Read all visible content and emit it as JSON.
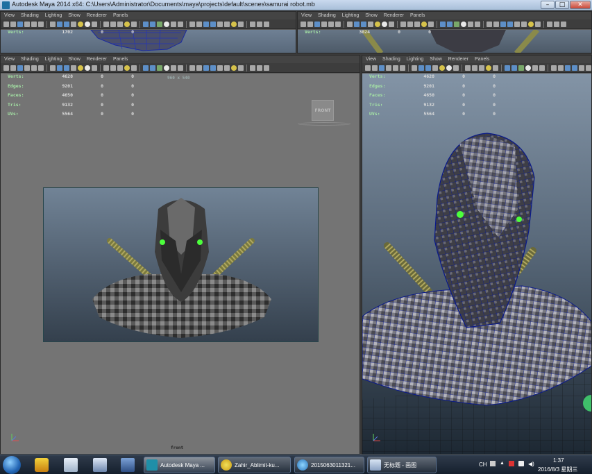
{
  "window": {
    "title": "Autodesk Maya 2014 x64: C:\\Users\\Administrator\\Documents\\maya\\projects\\default\\scenes\\samurai robot.mb",
    "controls": {
      "minimize": "–",
      "maximize": "□",
      "close": "✕"
    }
  },
  "panel_menu": [
    "View",
    "Shading",
    "Lighting",
    "Show",
    "Renderer",
    "Panels"
  ],
  "top_left_panel": {
    "hud": [
      {
        "label": "Verts:",
        "values": [
          "1702",
          "0",
          "0"
        ]
      }
    ]
  },
  "top_right_panel": {
    "hud": [
      {
        "label": "Verts:",
        "values": [
          "3024",
          "0",
          "0"
        ]
      }
    ]
  },
  "front_panel": {
    "resolution": "960 x 540",
    "cube_label": "FRONT",
    "camera_label": "front",
    "hud": [
      {
        "label": "Verts:",
        "values": [
          "4628",
          "0",
          "0"
        ]
      },
      {
        "label": "Edges:",
        "values": [
          "9201",
          "0",
          "0"
        ]
      },
      {
        "label": "Faces:",
        "values": [
          "4650",
          "0",
          "0"
        ]
      },
      {
        "label": "Tris:",
        "values": [
          "9132",
          "0",
          "0"
        ]
      },
      {
        "label": "UVs:",
        "values": [
          "5564",
          "0",
          "0"
        ]
      }
    ]
  },
  "persp_panel": {
    "hud": [
      {
        "label": "Verts:",
        "values": [
          "4628",
          "0",
          "0"
        ]
      },
      {
        "label": "Edges:",
        "values": [
          "9201",
          "0",
          "0"
        ]
      },
      {
        "label": "Faces:",
        "values": [
          "4650",
          "0",
          "0"
        ]
      },
      {
        "label": "Tris:",
        "values": [
          "9132",
          "0",
          "0"
        ]
      },
      {
        "label": "UVs:",
        "values": [
          "5564",
          "0",
          "0"
        ]
      }
    ]
  },
  "taskbar": {
    "tasks": [
      {
        "label": "Autodesk Maya ...",
        "icon": "maya-icon"
      },
      {
        "label": "Zahir_Ablimit-ku...",
        "icon": "chrome-icon"
      },
      {
        "label": "2015063011321...",
        "icon": "folder-icon"
      },
      {
        "label": "无标题 - 画图",
        "icon": "paint-icon"
      }
    ],
    "tray": {
      "lang": "CH",
      "time": "1:37",
      "date": "2016/8/3 星期三"
    }
  },
  "colors": {
    "viewport_bg_top": "#7b8fa3",
    "viewport_bg_bottom": "#3a4a5b",
    "hud_label": "#a5e5a5",
    "eye_glow": "#4cff3c",
    "wireframe": "#0a1a8a"
  }
}
